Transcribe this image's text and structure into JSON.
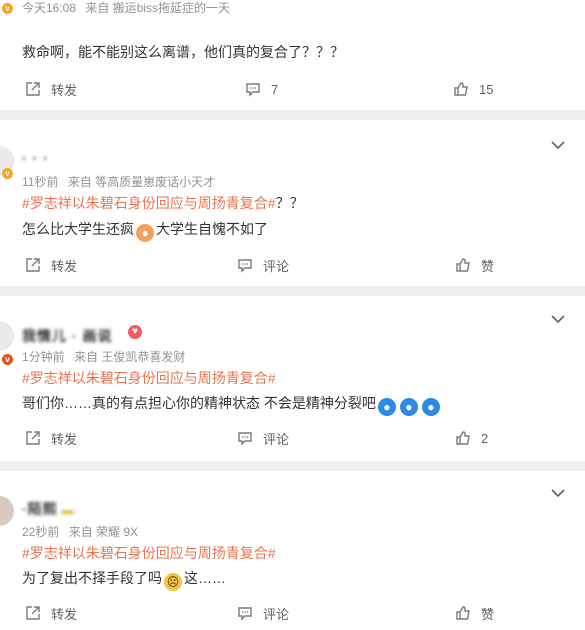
{
  "posts": [
    {
      "meta_time": "今天16:08",
      "meta_source": "来自 搬运biss拖延症的一天",
      "content": "救命啊，能不能别这么离谱，他们真的复合了？？？",
      "actions": {
        "forward": "转发",
        "comment": "7",
        "like": "15"
      }
    },
    {
      "username": "· · ·",
      "meta_time": "11秒前",
      "meta_source": "来自 等高质量崽废话小天才",
      "topic": "#罗志祥以朱碧石身份回应与周扬青复合#",
      "topic_suffix": "？？",
      "content_a": "怎么比大学生还疯",
      "content_b": "大学生自愧不如了",
      "actions": {
        "forward": "转发",
        "comment": "评论",
        "like": "赞"
      }
    },
    {
      "username": "我情儿 · 画说",
      "meta_time": "1分钟前",
      "meta_source": "来自 王俊凯恭喜发财",
      "topic": "#罗志祥以朱碧石身份回应与周扬青复合#",
      "content": "哥们你……真的有点担心你的精神状态 不会是精神分裂吧",
      "actions": {
        "forward": "转发",
        "comment": "评论",
        "like": "2"
      }
    },
    {
      "username": "·陌熙",
      "meta_time": "22秒前",
      "meta_source": "来自 荣耀 9X",
      "topic": "#罗志祥以朱碧石身份回应与周扬青复合#",
      "content_a": "为了复出不择手段了吗",
      "content_b": "这……",
      "actions": {
        "forward": "转发",
        "comment": "评论",
        "like": "赞"
      }
    }
  ],
  "colors": {
    "topic": "#eb7350",
    "meta": "#939393",
    "page_bg": "#f0f0f3"
  }
}
